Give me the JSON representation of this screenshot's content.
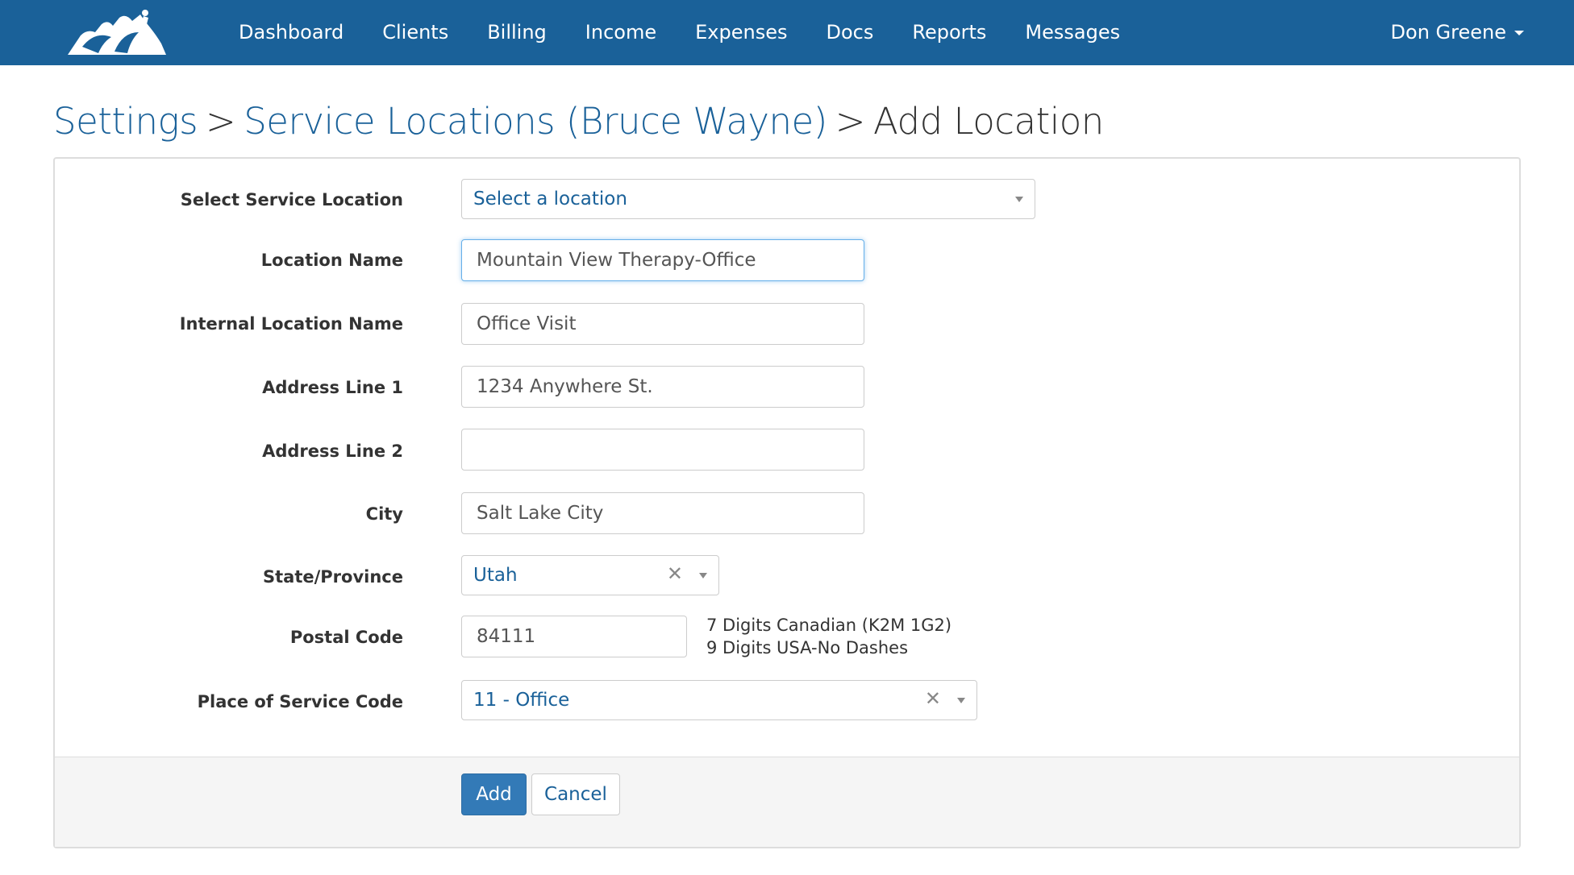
{
  "navbar": {
    "links": [
      "Dashboard",
      "Clients",
      "Billing",
      "Income",
      "Expenses",
      "Docs",
      "Reports",
      "Messages"
    ],
    "user": "Don Greene",
    "brand_color": "#1a6199"
  },
  "breadcrumb": {
    "settings": "Settings",
    "service_locations": "Service Locations (Bruce Wayne)",
    "current": "Add Location",
    "separator": ">"
  },
  "form": {
    "select_location": {
      "label": "Select Service Location",
      "value": "Select a location"
    },
    "location_name": {
      "label": "Location Name",
      "value": "Mountain View Therapy-Office"
    },
    "internal_location_name": {
      "label": "Internal Location Name",
      "value": "Office Visit"
    },
    "address_line_1": {
      "label": "Address Line 1",
      "value": "1234 Anywhere St."
    },
    "address_line_2": {
      "label": "Address Line 2",
      "value": ""
    },
    "city": {
      "label": "City",
      "value": "Salt Lake City"
    },
    "state": {
      "label": "State/Province",
      "value": "Utah"
    },
    "postal_code": {
      "label": "Postal Code",
      "value": "84111",
      "hint_line_1": "7 Digits Canadian (K2M 1G2)",
      "hint_line_2": "9 Digits USA-No Dashes"
    },
    "place_of_service": {
      "label": "Place of Service Code",
      "value": "11 - Office"
    }
  },
  "actions": {
    "add_label": "Add",
    "cancel_label": "Cancel"
  }
}
